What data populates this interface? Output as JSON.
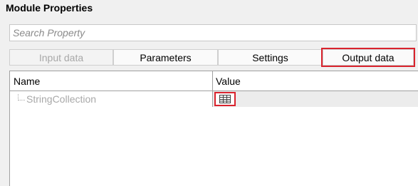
{
  "panel": {
    "title": "Module Properties"
  },
  "search": {
    "placeholder": "Search Property",
    "value": ""
  },
  "tabs": [
    {
      "label": "Input data",
      "state": "disabled"
    },
    {
      "label": "Parameters",
      "state": "normal"
    },
    {
      "label": "Settings",
      "state": "normal"
    },
    {
      "label": "Output data",
      "state": "selected-highlighted"
    }
  ],
  "grid": {
    "columns": [
      "Name",
      "Value"
    ],
    "rows": [
      {
        "name": "StringCollection",
        "value_icon": "table-grid-icon"
      }
    ]
  },
  "colors": {
    "highlight_red": "#d9232d",
    "disabled_text": "#a8a8a8",
    "panel_bg": "#f0f0f0"
  }
}
